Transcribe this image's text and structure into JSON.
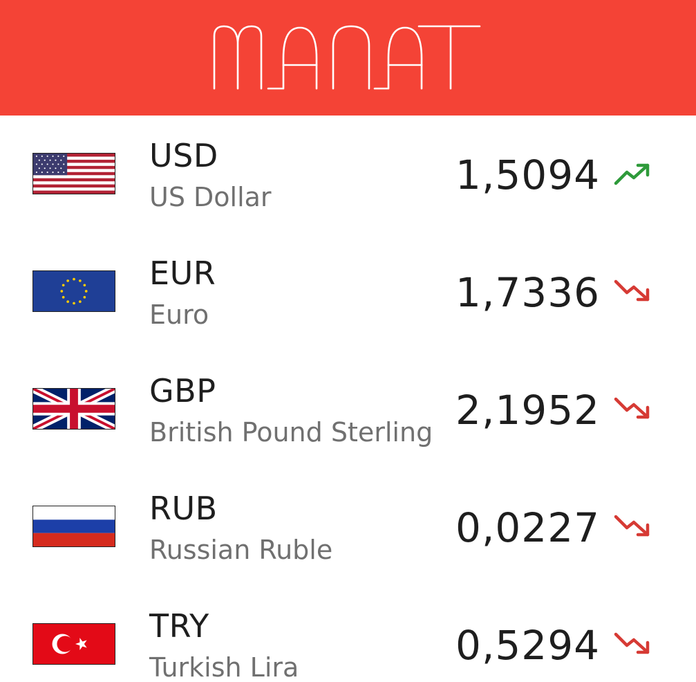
{
  "app": {
    "title": "MANAT",
    "header_color": "#f44336"
  },
  "trend_colors": {
    "up": "#2e9a3a",
    "down": "#d63a34"
  },
  "currencies": [
    {
      "code": "USD",
      "name": "US Dollar",
      "rate": "1,5094",
      "trend": "up",
      "trend_icon": "trending-up-icon",
      "flag_icon": "us-flag-icon"
    },
    {
      "code": "EUR",
      "name": "Euro",
      "rate": "1,7336",
      "trend": "down",
      "trend_icon": "trending-down-icon",
      "flag_icon": "eu-flag-icon"
    },
    {
      "code": "GBP",
      "name": "British Pound Sterling",
      "rate": "2,1952",
      "trend": "down",
      "trend_icon": "trending-down-icon",
      "flag_icon": "uk-flag-icon"
    },
    {
      "code": "RUB",
      "name": "Russian Ruble",
      "rate": "0,0227",
      "trend": "down",
      "trend_icon": "trending-down-icon",
      "flag_icon": "ru-flag-icon"
    },
    {
      "code": "TRY",
      "name": "Turkish Lira",
      "rate": "0,5294",
      "trend": "down",
      "trend_icon": "trending-down-icon",
      "flag_icon": "tr-flag-icon"
    }
  ]
}
